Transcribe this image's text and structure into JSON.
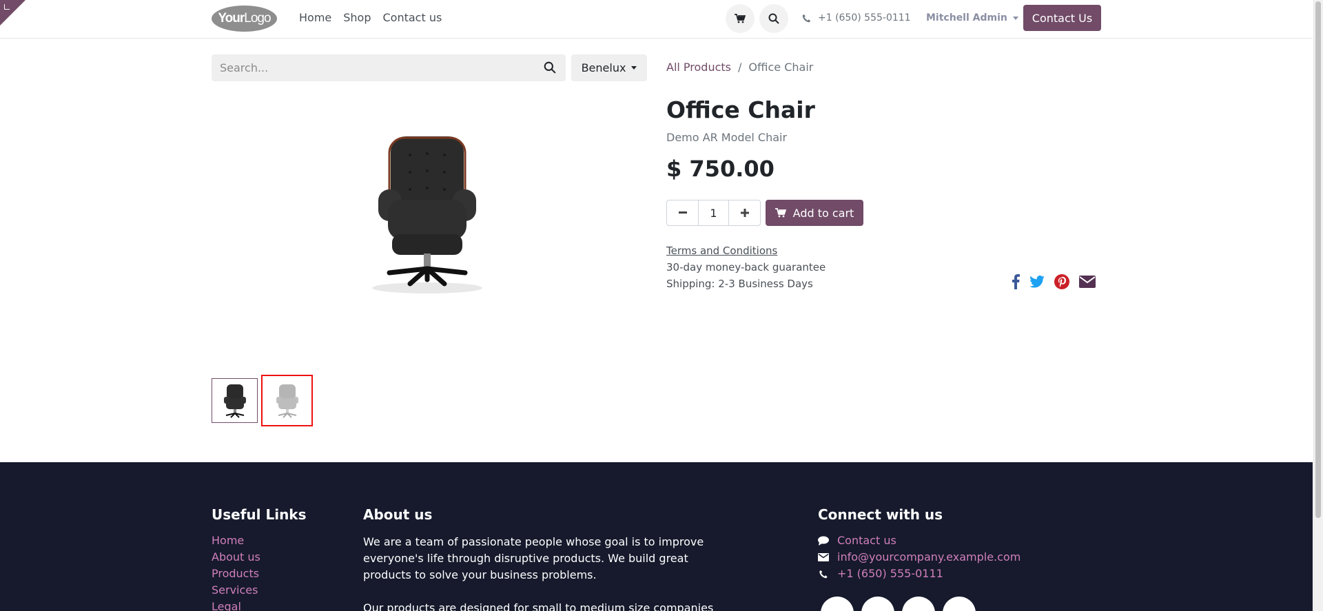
{
  "header": {
    "logo_bold": "Your",
    "logo_light": "Logo",
    "nav": [
      "Home",
      "Shop",
      "Contact us"
    ],
    "phone": "+1 (650) 555-0111",
    "user": "Mitchell Admin",
    "contact_button": "Contact Us"
  },
  "search": {
    "placeholder": "Search...",
    "pricelist": "Benelux"
  },
  "breadcrumb": {
    "all_products": "All Products",
    "separator": "/",
    "current": "Office Chair"
  },
  "product": {
    "title": "Office Chair",
    "subtitle": "Demo AR Model Chair",
    "price": "$ 750.00",
    "quantity": "1",
    "add_to_cart": "Add to cart",
    "terms": "Terms and Conditions",
    "guarantee": "30-day money-back guarantee",
    "shipping": "Shipping: 2-3 Business Days"
  },
  "share_icons": [
    "facebook-icon",
    "twitter-icon",
    "pinterest-icon",
    "envelope-icon"
  ],
  "footer": {
    "useful_links_title": "Useful Links",
    "useful_links": [
      "Home",
      "About us",
      "Products",
      "Services",
      "Legal"
    ],
    "about_title": "About us",
    "about_p1": "We are a team of passionate people whose goal is to improve everyone's life through disruptive products. We build great products to solve your business problems.",
    "about_p2": "Our products are designed for small to medium size companies willing",
    "connect_title": "Connect with us",
    "connect_contact": "Contact us",
    "connect_email": "info@yourcompany.example.com",
    "connect_phone": "+1 (650) 555-0111"
  },
  "colors": {
    "brand": "#714b67",
    "footer_bg": "#161a2c",
    "footer_link": "#d17fbc"
  }
}
